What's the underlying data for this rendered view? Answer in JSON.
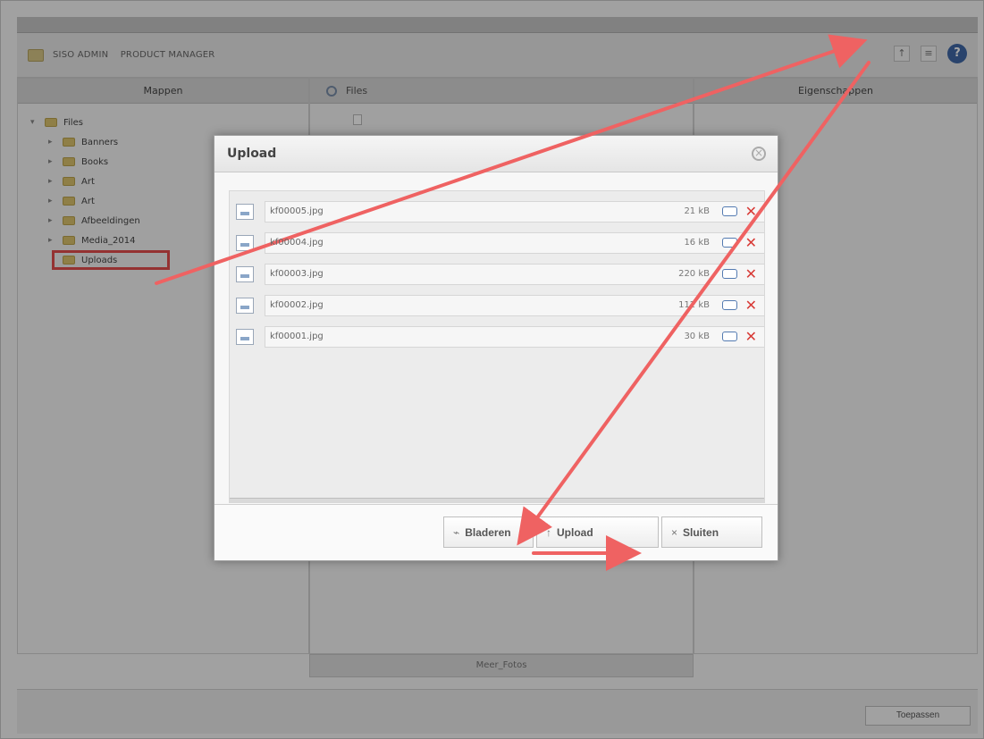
{
  "app": {
    "breadcrumb": [
      "SISO ADMIN",
      "PRODUCT MANAGER"
    ],
    "help_icon": "help-icon",
    "toolbar_icons": [
      "arrow-icon",
      "menu-icon",
      "help-icon"
    ]
  },
  "left_panel": {
    "title": "Mappen",
    "tree": [
      {
        "label": "Files",
        "expanded": true
      },
      {
        "label": "Banners"
      },
      {
        "label": "Books"
      },
      {
        "label": "Art"
      },
      {
        "label": "Art"
      },
      {
        "label": "Afbeeldingen"
      },
      {
        "label": "Media_2014"
      },
      {
        "label": "Uploads",
        "selected": true
      }
    ]
  },
  "center_panel": {
    "title": "Files",
    "status": "Meer_Fotos"
  },
  "right_panel": {
    "title": "Eigenschappen"
  },
  "footer": {
    "button": "Toepassen"
  },
  "dialog": {
    "title": "Upload",
    "files": [
      {
        "name": "kf00005.jpg",
        "size": "21 kB"
      },
      {
        "name": "kf00004.jpg",
        "size": "16 kB"
      },
      {
        "name": "kf00003.jpg",
        "size": "220 kB"
      },
      {
        "name": "kf00002.jpg",
        "size": "112 kB"
      },
      {
        "name": "kf00001.jpg",
        "size": "30 kB"
      }
    ],
    "buttons": {
      "browse": "Bladeren",
      "upload": "Upload",
      "close": "Sluiten"
    }
  },
  "annotation_color": "#ef6262"
}
